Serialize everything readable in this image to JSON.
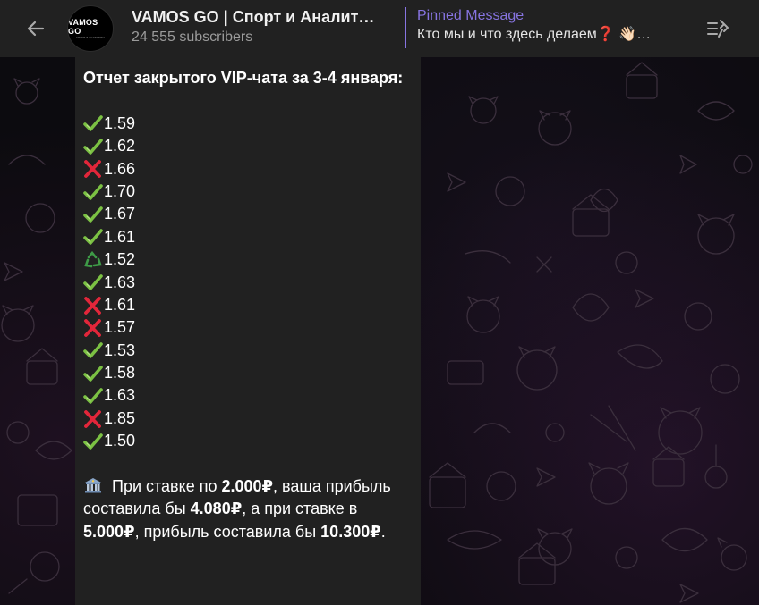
{
  "header": {
    "back_icon": "arrow-left-icon",
    "avatar_text": "VAMOS GO",
    "avatar_subtext": "СПОРТ И АНАЛИТИКА",
    "title": "VAMOS GO | Спорт и Аналит…",
    "subscribers": "24 555 subscribers",
    "pinned_label": "Pinned Message",
    "pinned_text": "Кто мы и что здесь делаем❓ 👋🏻…",
    "pinned_list_icon": "pinned-list-icon",
    "accent_color": "#8774e1"
  },
  "message": {
    "heading": "Отчет закрытого VIP-чата за 3-4 января:",
    "results": [
      {
        "status": "win",
        "icon": "check-mark-icon",
        "odds": "1.59"
      },
      {
        "status": "win",
        "icon": "check-mark-icon",
        "odds": "1.62"
      },
      {
        "status": "loss",
        "icon": "cross-mark-icon",
        "odds": "1.66"
      },
      {
        "status": "win",
        "icon": "check-mark-icon",
        "odds": "1.70"
      },
      {
        "status": "win",
        "icon": "check-mark-icon",
        "odds": "1.67"
      },
      {
        "status": "win",
        "icon": "check-mark-icon",
        "odds": "1.61"
      },
      {
        "status": "refund",
        "icon": "recycle-icon",
        "odds": "1.52"
      },
      {
        "status": "win",
        "icon": "check-mark-icon",
        "odds": "1.63"
      },
      {
        "status": "loss",
        "icon": "cross-mark-icon",
        "odds": "1.61"
      },
      {
        "status": "loss",
        "icon": "cross-mark-icon",
        "odds": "1.57"
      },
      {
        "status": "win",
        "icon": "check-mark-icon",
        "odds": "1.53"
      },
      {
        "status": "win",
        "icon": "check-mark-icon",
        "odds": "1.58"
      },
      {
        "status": "win",
        "icon": "check-mark-icon",
        "odds": "1.63"
      },
      {
        "status": "loss",
        "icon": "cross-mark-icon",
        "odds": "1.85"
      },
      {
        "status": "win",
        "icon": "check-mark-icon",
        "odds": "1.50"
      }
    ],
    "summary": {
      "icon": "bank-icon",
      "part1": "При ставке по ",
      "bet1": "2.000₽",
      "part2": ", ваша прибыль составила бы ",
      "profit1": "4.080₽",
      "part3": ", а при ставке в ",
      "bet2": "5.000₽",
      "part4": ", прибыль составила бы ",
      "profit2": "10.300₽",
      "part5": "."
    }
  },
  "colors": {
    "header_bg": "#212121",
    "bubble_bg": "#212121",
    "win": "#7bc143",
    "loss": "#e2263a",
    "refund": "#3e9b47"
  }
}
